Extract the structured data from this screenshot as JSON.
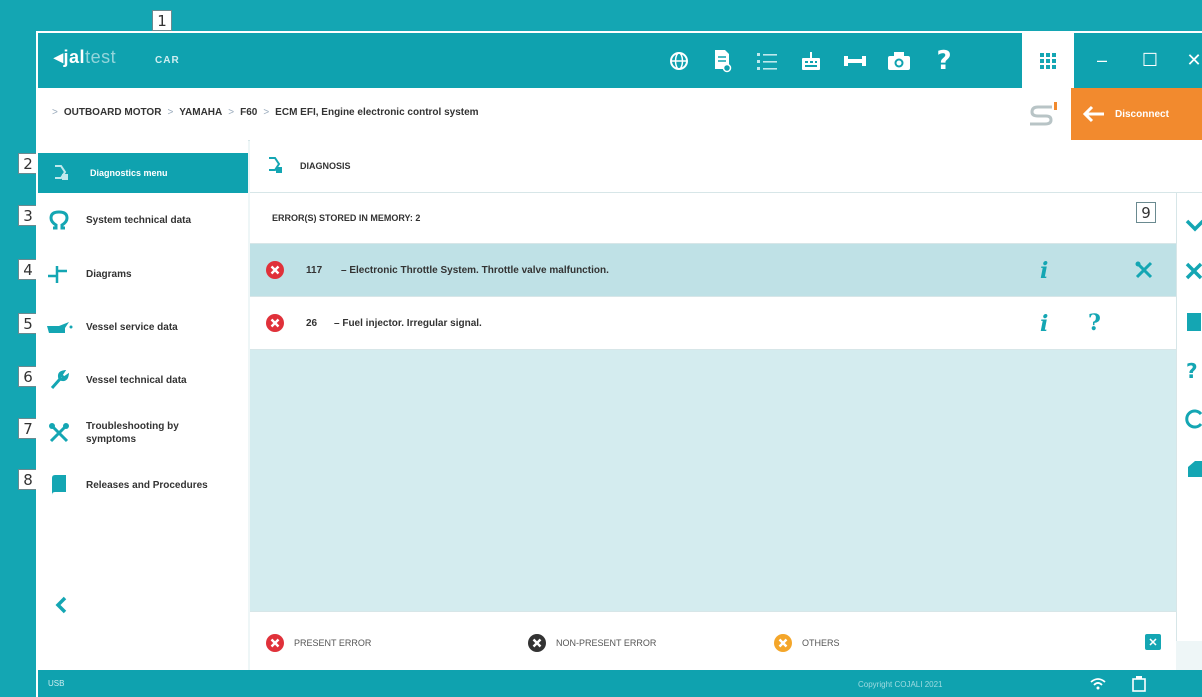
{
  "callouts": [
    "1",
    "2",
    "3",
    "4",
    "5",
    "6",
    "7",
    "8",
    "9"
  ],
  "app": {
    "logo_main": "jal",
    "logo_light": "test",
    "module": "CAR",
    "apps_icon": "grid-icon"
  },
  "toolbar": {
    "icons": [
      "globe-icon",
      "document-search-icon",
      "list-icon",
      "keyboard-icon",
      "dyno-icon",
      "camera-icon",
      "help-icon"
    ],
    "help_label": "?"
  },
  "window_controls": {
    "minimize": "–",
    "maximize": "☐",
    "close": "✕"
  },
  "breadcrumb": {
    "items": [
      "OUTBOARD MOTOR",
      "YAMAHA",
      "F60",
      "ECM EFI, Engine electronic control system"
    ],
    "separator": ">"
  },
  "disconnect": {
    "label": "Disconnect"
  },
  "sidebar": {
    "header": "Diagnostics menu",
    "items": [
      {
        "label": "System technical data",
        "icon": "omega-icon"
      },
      {
        "label": "Diagrams",
        "icon": "diagram-icon"
      },
      {
        "label": "Vessel service data",
        "icon": "oil-can-icon"
      },
      {
        "label": "Vessel technical data",
        "icon": "wrench-icon"
      },
      {
        "label": "Troubleshooting by symptoms",
        "icon": "tools-icon"
      },
      {
        "label": "Releases and Procedures",
        "icon": "manual-icon"
      }
    ],
    "back_icon": "chevron-left-icon"
  },
  "diagnosis": {
    "title": "DIAGNOSIS",
    "errors_header": "ERROR(S) STORED IN MEMORY: 2",
    "errors": [
      {
        "code": "117",
        "dash": "–",
        "description": "Electronic Throttle System. Throttle valve malfunction.",
        "status": "present"
      },
      {
        "code": "26",
        "dash": "–",
        "description": "Fuel injector. Irregular signal.",
        "status": "present"
      }
    ],
    "info_glyph": "i",
    "help_glyph": "?"
  },
  "legend": {
    "present": "PRESENT ERROR",
    "non_present": "NON-PRESENT ERROR",
    "others": "OTHERS",
    "close_glyph": "✕"
  },
  "status": {
    "left": "USB",
    "right": "Copyright COJALI 2021"
  },
  "colors": {
    "teal": "#0fa2af",
    "orange": "#f28a2e",
    "error_red": "#e0313a",
    "non_present_gray": "#333333",
    "others_orange": "#f4a62a",
    "panel_bg": "#d4ecef",
    "selected_row": "#bfe1e6"
  }
}
